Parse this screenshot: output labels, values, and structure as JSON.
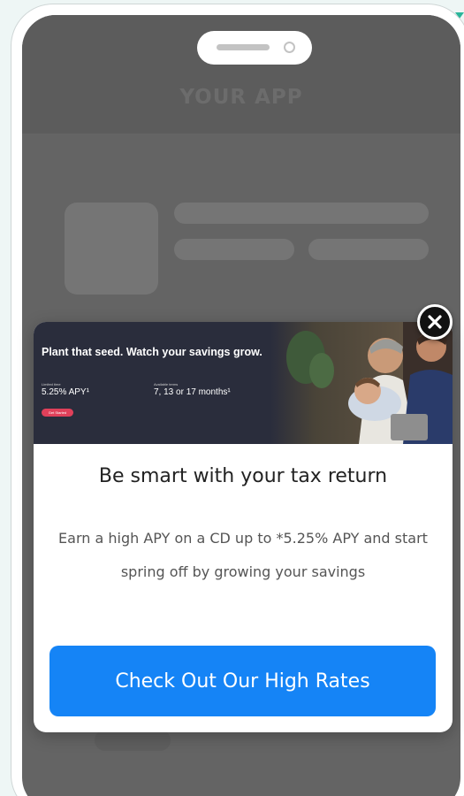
{
  "app": {
    "title": "YOUR APP"
  },
  "banner": {
    "headline": "Plant that seed. Watch your savings grow.",
    "rate_caption": "Limited time",
    "rate": "5.25% APY¹",
    "term_caption": "Available terms",
    "terms": "7, 13 or 17 months¹",
    "cta_label": "Get Started"
  },
  "modal": {
    "heading": "Be smart with your tax return",
    "body": "Earn a high APY on a CD up to *5.25% APY and start spring off by growing your savings",
    "cta_label": "Check Out Our High Rates",
    "close_icon": "close-icon"
  },
  "colors": {
    "cta": "#1584f6",
    "banner_bg": "#2a2d3c",
    "banner_cta": "#e0405a",
    "screen_bg": "#646464",
    "accent_mark": "#2bb59a"
  }
}
